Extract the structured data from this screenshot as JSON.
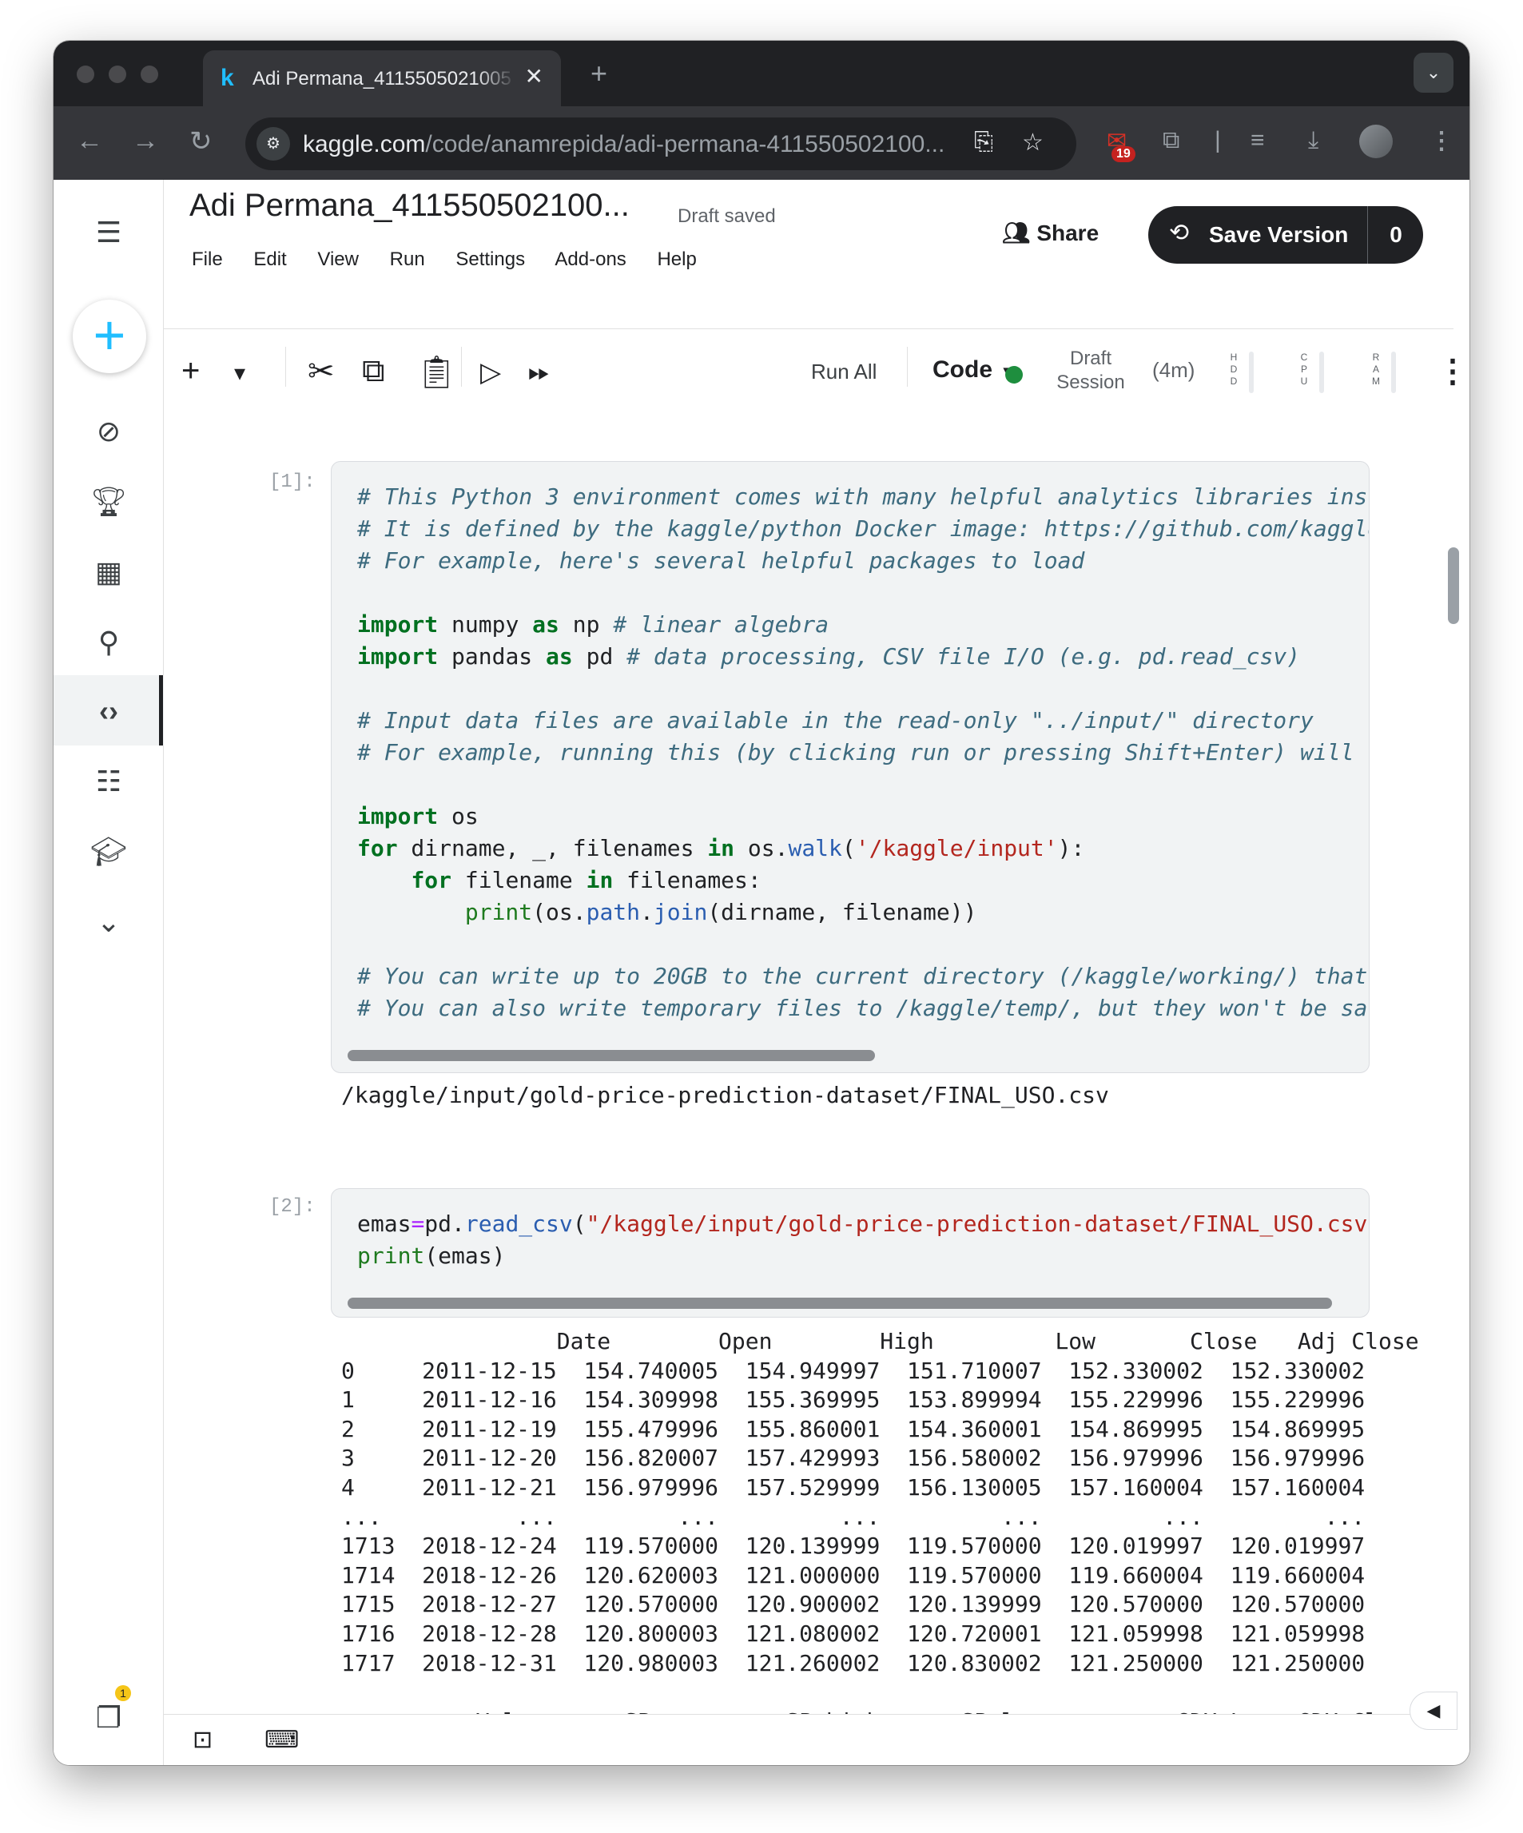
{
  "browser": {
    "tab_title": "Adi Permana_4115505021005",
    "tab_favicon": "k",
    "url_host": "kaggle.com",
    "url_path": "/code/anamrepida/adi-permana-411550502100...",
    "extension_badge": "19"
  },
  "notebook": {
    "title": "Adi Permana_411550502100...",
    "status": "Draft saved",
    "menu": [
      "File",
      "Edit",
      "View",
      "Run",
      "Settings",
      "Add-ons",
      "Help"
    ],
    "share_label": "Share",
    "save_label": "Save Version",
    "save_count": "0"
  },
  "toolbar": {
    "run_all_label": "Run All",
    "cell_type": "Code",
    "session_line1": "Draft",
    "session_line2": "Session",
    "session_time": "(4m)",
    "meters": [
      "HDD",
      "CPU",
      "RAM"
    ]
  },
  "sidebar": {
    "notification_count": "1",
    "icons": [
      "menu-icon",
      "create-icon",
      "compass-icon",
      "trophy-icon",
      "table-icon",
      "models-icon",
      "code-icon",
      "discussion-icon",
      "learn-icon",
      "chevron-down-icon",
      "copy-icon"
    ]
  },
  "cells": [
    {
      "prompt": "[1]:",
      "output": "/kaggle/input/gold-price-prediction-dataset/FINAL_USO.csv"
    },
    {
      "prompt": "[2]:",
      "output": "                Date        Open        High         Low       Close   Adj Close  \\\n0     2011-12-15  154.740005  154.949997  151.710007  152.330002  152.330002\n1     2011-12-16  154.309998  155.369995  153.899994  155.229996  155.229996\n2     2011-12-19  155.479996  155.860001  154.360001  154.869995  154.869995\n3     2011-12-20  156.820007  157.429993  156.580002  156.979996  156.979996\n4     2011-12-21  156.979996  157.529999  156.130005  157.160004  157.160004\n...          ...         ...         ...         ...         ...         ...\n1713  2018-12-24  119.570000  120.139999  119.570000  120.019997  120.019997\n1714  2018-12-26  120.620003  121.000000  119.570000  119.660004  119.660004\n1715  2018-12-27  120.570000  120.900002  120.139999  120.570000  120.570000\n1716  2018-12-28  120.800003  121.080002  120.720001  121.059998  121.059998\n1717  2018-12-31  120.980003  121.260002  120.830002  121.250000  121.250000\n\n          Volume     SP_open     SP_high      SP_low  ...     GDX_Low  GDX_Close"
    }
  ],
  "colors": {
    "kaggle_blue": "#20beff",
    "status_green": "#1e8e3e",
    "save_button": "#202124"
  }
}
